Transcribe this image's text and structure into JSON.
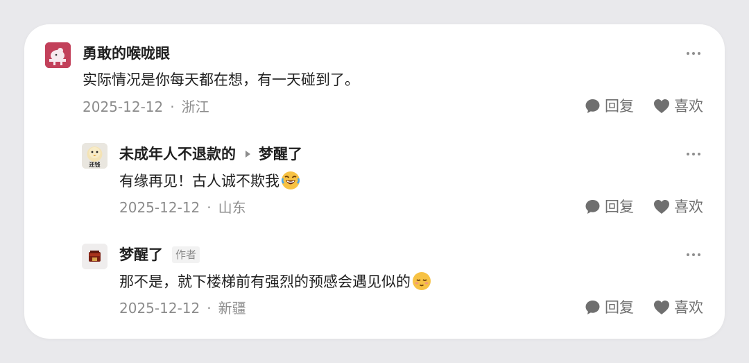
{
  "comments": [
    {
      "username": "勇敢的喉咙眼",
      "text": "实际情况是你每天都在想，有一天碰到了。",
      "date": "2025-12-12",
      "separator": "·",
      "location": "浙江",
      "reply_label": "回复",
      "like_label": "喜欢"
    },
    {
      "username": "未成年人不退款的",
      "reply_to": "梦醒了",
      "avatar_text": "还钱",
      "text": "有缘再见！古人诚不欺我",
      "emoji": "laughing-crying-emoji",
      "date": "2025-12-12",
      "separator": "·",
      "location": "山东",
      "reply_label": "回复",
      "like_label": "喜欢"
    },
    {
      "username": "梦醒了",
      "author_tag": "作者",
      "text": "那不是，就下楼梯前有强烈的预感会遇见似的",
      "emoji": "relieved-face-emoji",
      "date": "2025-12-12",
      "separator": "·",
      "location": "新疆",
      "reply_label": "回复",
      "like_label": "喜欢"
    }
  ],
  "colors": {
    "username": "#1f1f1f",
    "meta": "#8c8c8c",
    "action": "#707070",
    "background": "#ffffff"
  }
}
